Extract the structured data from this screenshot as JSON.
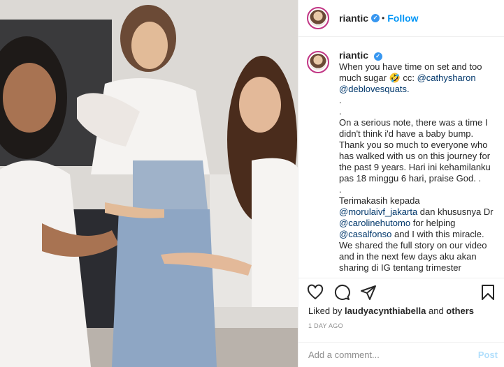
{
  "colors": {
    "accent": "#0095f6",
    "mention": "#00376b",
    "verified": "#3897f0",
    "muted": "#8e8e8e"
  },
  "header": {
    "username": "riantic",
    "verified_icon": "verified-badge-icon",
    "separator": "•",
    "follow_label": "Follow"
  },
  "caption": {
    "username": "riantic",
    "lines": [
      "When you have time on set and too",
      "much sugar 🤣 cc: ",
      "@deblovesquats.",
      ".",
      ".",
      "On a serious note, there was a time I",
      "didn't think i'd have a baby bump.",
      "Thank you so much to everyone who",
      "has walked with us on this journey for",
      "the past 9 years. Hari ini kehamilanku",
      "pas 18 minggu 6 hari, praise God. .",
      ".",
      "Terimakasih kepada",
      "@morulaivf_jakarta",
      " dan khususnya Dr",
      "@carolinehutomo",
      " for helping",
      "@casalfonso",
      " and I with this miracle.",
      "We shared the full story on our video",
      "and in the next few days aku akan",
      "sharing di IG tentang trimester"
    ],
    "mention_cathy": "@cathysharon"
  },
  "actions": {
    "like_icon": "heart-icon",
    "comment_icon": "comment-icon",
    "share_icon": "paper-plane-icon",
    "save_icon": "bookmark-icon"
  },
  "likes": {
    "prefix": "Liked by ",
    "user": "laudyacynthiabella",
    "middle": " and ",
    "others": "others"
  },
  "date": "1 DAY AGO",
  "comment_box": {
    "placeholder": "Add a comment...",
    "post_label": "Post"
  }
}
